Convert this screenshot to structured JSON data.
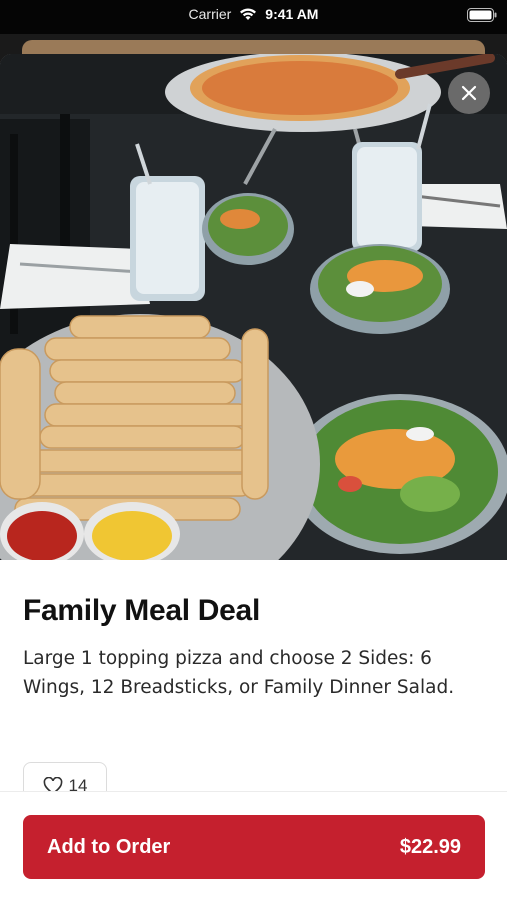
{
  "status_bar": {
    "carrier": "Carrier",
    "time": "9:41 AM",
    "icons": [
      "wifi-icon",
      "battery-icon"
    ]
  },
  "hero": {
    "image": "photo of pizza, breadsticks with dipping sauces, salads and iced drinks on a dark table",
    "close_icon": "close-icon"
  },
  "item": {
    "title": "Family Meal Deal",
    "description": "Large 1 topping pizza and choose 2 Sides:  6 Wings, 12 Breadsticks, or Family Dinner Salad."
  },
  "likes": {
    "icon": "heart-icon",
    "count": "14"
  },
  "order": {
    "add_label": "Add to Order",
    "price": "$22.99"
  },
  "colors": {
    "accent": "#c5202e",
    "status_bar_bg": "#050505"
  }
}
